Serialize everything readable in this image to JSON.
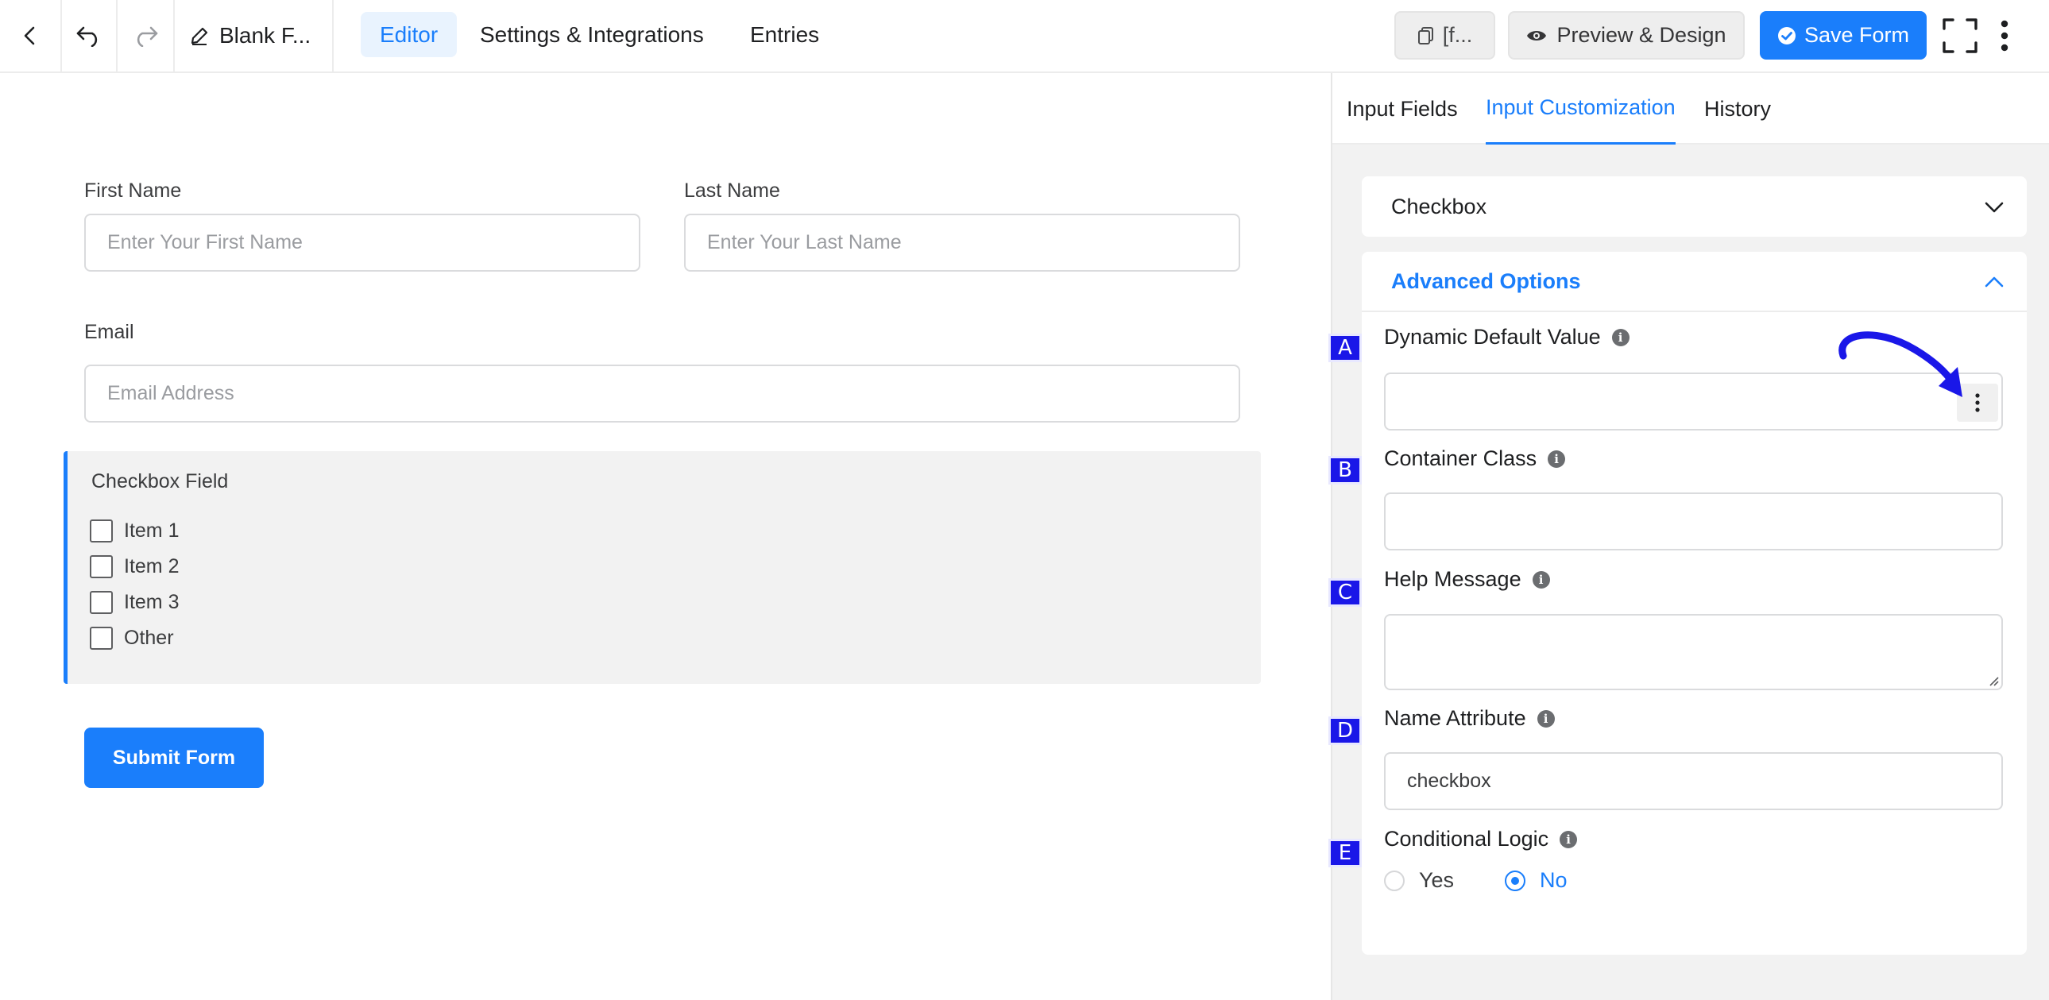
{
  "toolbar": {
    "form_title": "Blank F...",
    "nav": [
      {
        "label": "Editor",
        "active": true
      },
      {
        "label": "Settings & Integrations",
        "active": false
      },
      {
        "label": "Entries",
        "active": false
      }
    ],
    "shortcode_label": "[f...",
    "preview_label": "Preview & Design",
    "save_label": "Save Form"
  },
  "form": {
    "first_name": {
      "label": "First Name",
      "placeholder": "Enter Your First Name"
    },
    "last_name": {
      "label": "Last Name",
      "placeholder": "Enter Your Last Name"
    },
    "email": {
      "label": "Email",
      "placeholder": "Email Address"
    },
    "checkbox_field": {
      "title": "Checkbox Field",
      "items": [
        "Item 1",
        "Item 2",
        "Item 3",
        "Other"
      ]
    },
    "submit_label": "Submit Form"
  },
  "sidebar": {
    "tabs": [
      {
        "label": "Input Fields",
        "active": false
      },
      {
        "label": "Input Customization",
        "active": true
      },
      {
        "label": "History",
        "active": false
      }
    ],
    "field_type": "Checkbox",
    "advanced_title": "Advanced Options",
    "fields": {
      "dynamic_default": {
        "marker": "A",
        "label": "Dynamic Default Value",
        "value": ""
      },
      "container_class": {
        "marker": "B",
        "label": "Container Class",
        "value": ""
      },
      "help_message": {
        "marker": "C",
        "label": "Help Message",
        "value": ""
      },
      "name_attribute": {
        "marker": "D",
        "label": "Name Attribute",
        "value": "checkbox"
      },
      "conditional_logic": {
        "marker": "E",
        "label": "Conditional Logic",
        "options": [
          "Yes",
          "No"
        ],
        "selected": "No"
      }
    }
  },
  "colors": {
    "accent": "#1a7efb",
    "marker": "#1a17e8",
    "annotation_arrow": "#1a17e8"
  }
}
